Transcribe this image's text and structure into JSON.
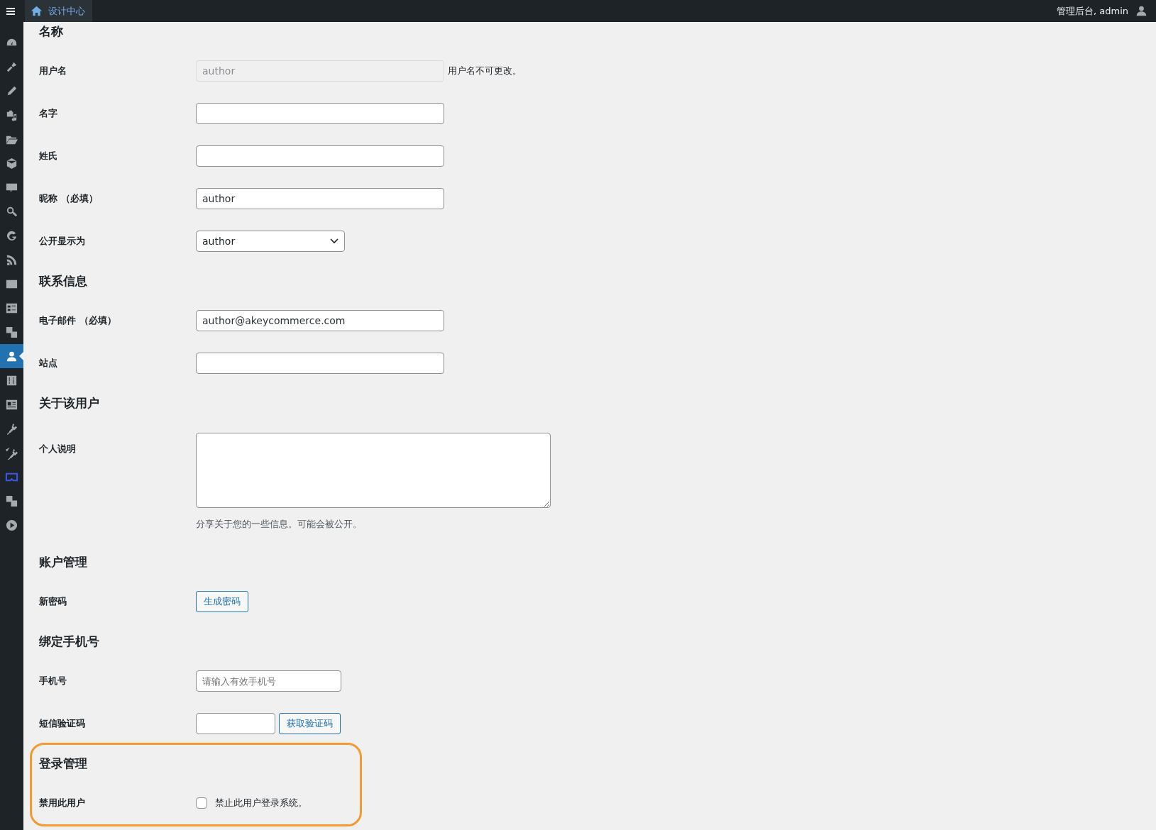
{
  "top_bar": {
    "site_name": "设计中心",
    "account": "管理后台, admin"
  },
  "sidebar": {
    "items": [
      {
        "selected": false
      },
      {
        "selected": false
      },
      {
        "selected": false
      },
      {
        "selected": false
      },
      {
        "selected": false
      },
      {
        "selected": false
      },
      {
        "selected": false
      },
      {
        "selected": false
      },
      {
        "selected": false
      },
      {
        "selected": false
      },
      {
        "selected": false
      },
      {
        "selected": false
      },
      {
        "selected": false
      },
      {
        "selected": true
      },
      {
        "selected": false
      },
      {
        "selected": false
      },
      {
        "selected": false
      },
      {
        "selected": false
      },
      {
        "selected": false
      },
      {
        "selected": false
      },
      {
        "selected": false
      }
    ]
  },
  "sections": [
    {
      "heading": "名称",
      "highlighted": false,
      "rows": [
        {
          "kind": "readonly",
          "label": "用户名",
          "value": "author",
          "note": "用户名不可更改。"
        },
        {
          "kind": "text",
          "label": "名字"
        },
        {
          "kind": "text",
          "label": "姓氏"
        },
        {
          "kind": "text",
          "label": "昵称 （必填）",
          "value": "author"
        },
        {
          "kind": "select",
          "label": "公开显示为",
          "value": "author"
        }
      ]
    },
    {
      "heading": "联系信息",
      "highlighted": false,
      "rows": [
        {
          "kind": "text",
          "label": "电子邮件 （必填）",
          "value": "author@akeycommerce.com"
        },
        {
          "kind": "text",
          "label": "站点"
        }
      ]
    },
    {
      "heading": "关于该用户",
      "highlighted": false,
      "rows": [
        {
          "kind": "textarea",
          "label": "个人说明",
          "description": "分享关于您的一些信息。可能会被公开。"
        }
      ]
    },
    {
      "heading": "账户管理",
      "highlighted": false,
      "rows": [
        {
          "kind": "button",
          "label": "新密码",
          "button": "生成密码"
        }
      ]
    },
    {
      "heading": "绑定手机号",
      "highlighted": false,
      "rows": [
        {
          "kind": "phone",
          "label": "手机号",
          "placeholder": "请输入有效手机号"
        },
        {
          "kind": "sms",
          "label": "短信验证码",
          "button": "获取验证码"
        }
      ]
    },
    {
      "heading": "登录管理",
      "highlighted": true,
      "rows": [
        {
          "kind": "checkbox",
          "label": "禁用此用户",
          "checked": false,
          "text": "禁止此用户登录系统。"
        }
      ]
    }
  ]
}
